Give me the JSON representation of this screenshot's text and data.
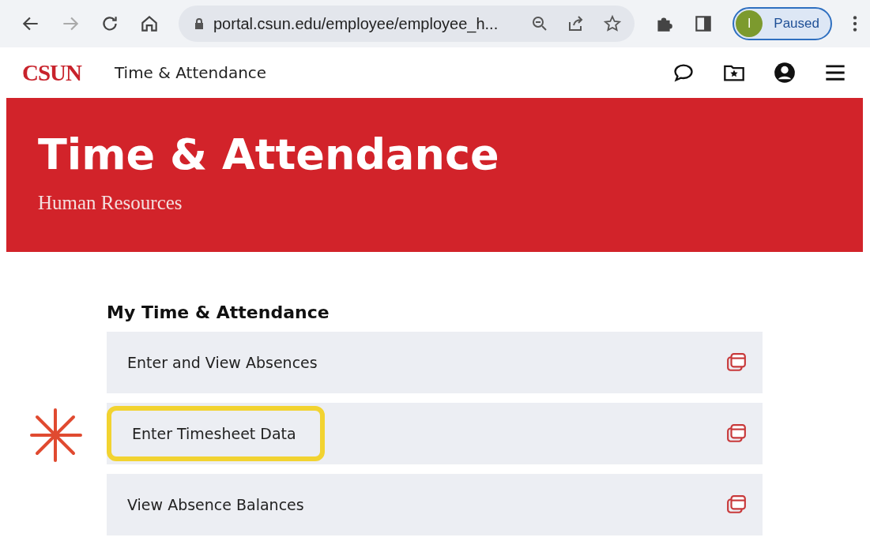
{
  "browser": {
    "url": "portal.csun.edu/employee/employee_h...",
    "profile_initial": "I",
    "profile_status": "Paused"
  },
  "site_header": {
    "logo": "CSUN",
    "title": "Time & Attendance"
  },
  "banner": {
    "title": "Time & Attendance",
    "subtitle": "Human Resources"
  },
  "section": {
    "heading": "My Time & Attendance",
    "items": [
      {
        "label": "Enter and View Absences",
        "marked": false
      },
      {
        "label": "Enter Timesheet Data",
        "marked": true
      },
      {
        "label": "View Absence Balances",
        "marked": false
      }
    ]
  }
}
